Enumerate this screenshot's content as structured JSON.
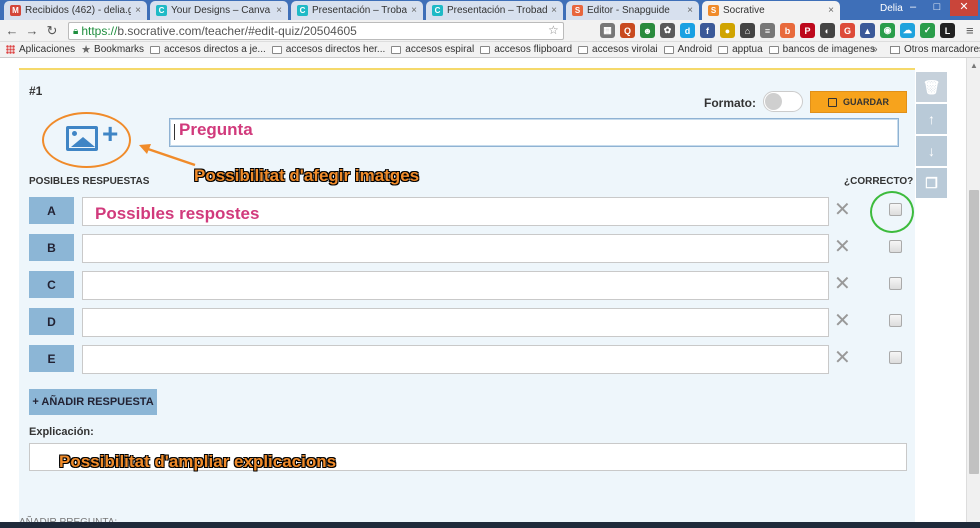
{
  "browser": {
    "tabs": [
      {
        "title": "Recibidos (462) - delia.ga...",
        "fav_letter": "M",
        "fav_color": "#d44638"
      },
      {
        "title": "Your Designs – Canva",
        "fav_letter": "C",
        "fav_color": "#1fbac6"
      },
      {
        "title": "Presentación – Trobada e...",
        "fav_letter": "C",
        "fav_color": "#1fbac6"
      },
      {
        "title": "Presentación – Trobada e...",
        "fav_letter": "C",
        "fav_color": "#1fbac6"
      },
      {
        "title": "Editor - Snapguide",
        "fav_letter": "S",
        "fav_color": "#e8663d"
      },
      {
        "title": "Socrative",
        "fav_letter": "S",
        "fav_color": "#f08b2a"
      }
    ],
    "user_name": "Delia",
    "url_scheme": "https://",
    "url_rest": "b.socrative.com/teacher/#edit-quiz/20504605",
    "bookmarks": [
      "Aplicaciones",
      "Bookmarks",
      "accesos directos a je...",
      "accesos directos her...",
      "accesos espiral",
      "accesos flipboard",
      "accesos virolai",
      "Android",
      "apptua",
      "bancos de imagenes"
    ],
    "bookmarks_more": "»",
    "other_bookmarks": "Otros marcadores",
    "ext_icons": [
      {
        "label": "Q",
        "color": "#c84a1f"
      },
      {
        "label": "f",
        "color": "#3b5998"
      },
      {
        "label": "d",
        "color": "#1ba1e2"
      },
      {
        "label": "P",
        "color": "#bd081c"
      },
      {
        "label": "G",
        "color": "#dd4b39"
      },
      {
        "label": "L",
        "color": "#222222"
      }
    ]
  },
  "quiz": {
    "question_number": "#1",
    "format_label": "Formato:",
    "save_label": "GUARDAR",
    "answers_header": "POSIBLES RESPUESTAS",
    "correct_header": "¿CORRECTO?",
    "answers": [
      {
        "letter": "A",
        "value": ""
      },
      {
        "letter": "B",
        "value": ""
      },
      {
        "letter": "C",
        "value": ""
      },
      {
        "letter": "D",
        "value": ""
      },
      {
        "letter": "E",
        "value": ""
      }
    ],
    "add_answer_label": "+ AÑADIR RESPUESTA",
    "explanation_label": "Explicación:",
    "next_label": "AÑADIR PREGUNTA:"
  },
  "annotations": {
    "question": "Pregunta",
    "images": "Possibilitat d'afegir imatges",
    "answers": "Possibles respostes",
    "explanation": "Possibilitat d'ampliar explicacions"
  }
}
